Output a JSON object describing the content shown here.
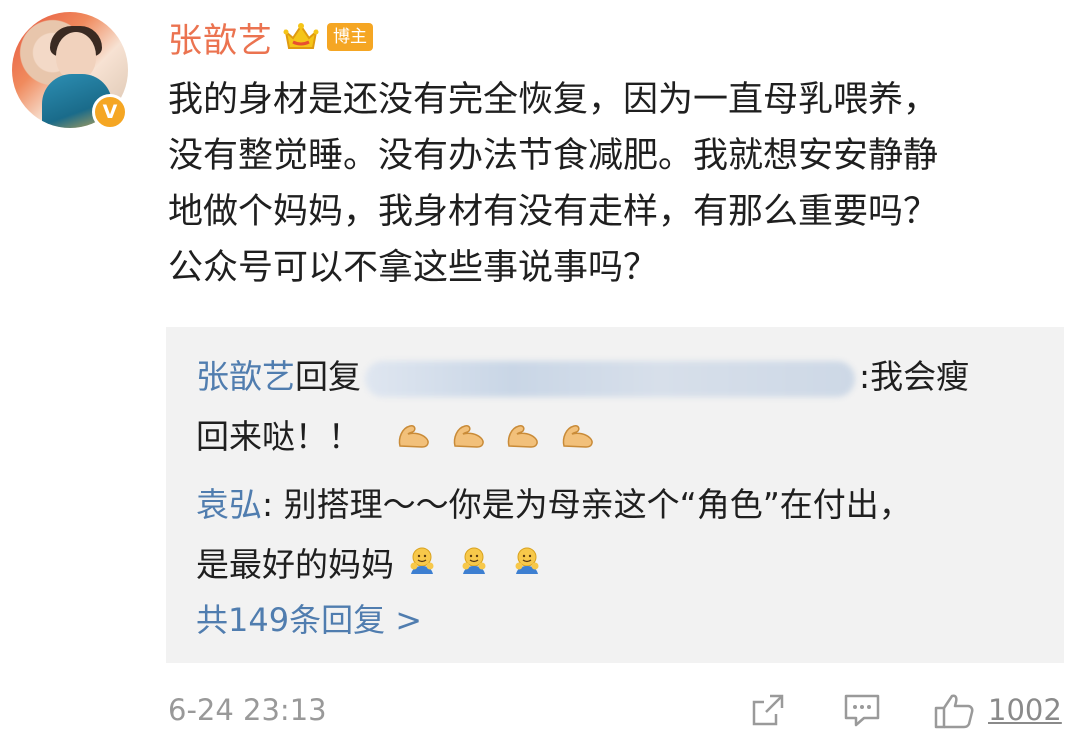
{
  "post": {
    "username": "张歆艺",
    "author_badge": "博主",
    "text_lines": [
      "我的身材是还没有完全恢复，因为一直母乳喂养，",
      "没有整觉睡。没有办法节食减肥。我就想安安静静",
      "地做个妈妈，我身材有没有走样，有那么重要吗？",
      "公众号可以不拿这些事说事吗？"
    ],
    "verified_badge": "V",
    "time": "6-24 23:13",
    "like_count": "1002"
  },
  "replies": [
    {
      "user": "张歆艺",
      "action": "回复",
      "text_after": ":我会瘦",
      "line2": "回来哒！！",
      "emoji": [
        "flexed-biceps",
        "flexed-biceps",
        "flexed-biceps",
        "flexed-biceps"
      ]
    },
    {
      "user": "袁弘",
      "line1": ": 别搭理～～你是为母亲这个“角色”在付出，",
      "line2": "是最好的妈妈",
      "emoji": [
        "hug",
        "hug",
        "hug"
      ]
    }
  ],
  "more_replies": "共149条回复 >",
  "icons": [
    "crown-icon",
    "share-icon",
    "comment-icon",
    "like-icon"
  ],
  "colors": {
    "username": "#eb7350",
    "link": "#507daf",
    "badge": "#f5a623",
    "reply_bg": "#f2f2f2"
  }
}
